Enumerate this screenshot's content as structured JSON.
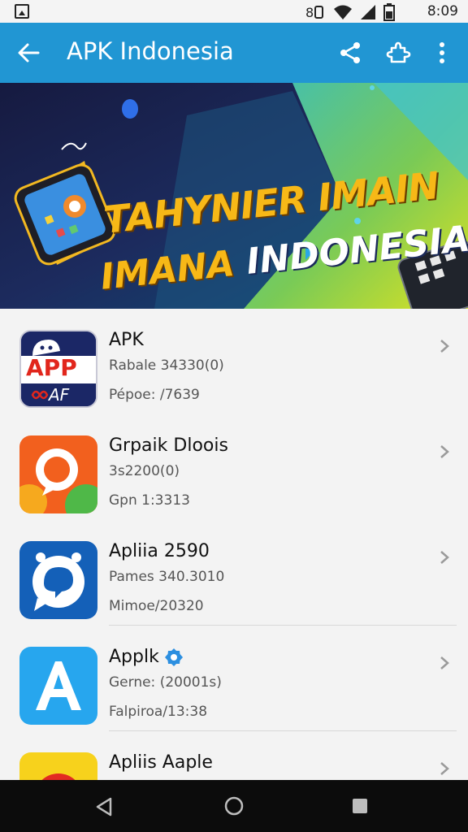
{
  "status_bar": {
    "time": "8:09"
  },
  "app_bar": {
    "title": "APK Indonesia"
  },
  "banner": {
    "line1": "TAHYNIER IMAIN",
    "line2_word1": "IMANA",
    "line2_word2": "INDONESIA"
  },
  "apps": [
    {
      "title": "APK",
      "line1": "Rabale 34330(0)",
      "line2": "Pépoe: /7639",
      "icon_text": "APP",
      "icon_subtext": "AF",
      "icon": "app-logo-icon"
    },
    {
      "title": "Grpaik Dloois",
      "line1": "3s2200(0)",
      "line2": "Gpn 1:3313",
      "icon": "chat-bubble-icon"
    },
    {
      "title": "Apliia 2590",
      "line1": "Pames 340.3010",
      "line2": "Mimoe/20320",
      "icon": "bot-chat-icon"
    },
    {
      "title": "Applk",
      "line1": "Gerne: (20001s)",
      "line2": "Falpiroa/13:38",
      "icon": "letter-a-icon",
      "verified": true
    },
    {
      "title": "Apliis Aaple",
      "icon": "red-circle-icon"
    }
  ],
  "colors": {
    "app_bar": "#2196d3",
    "list_bg": "#f3f3f3",
    "nav_bar": "#0c0c0c"
  }
}
